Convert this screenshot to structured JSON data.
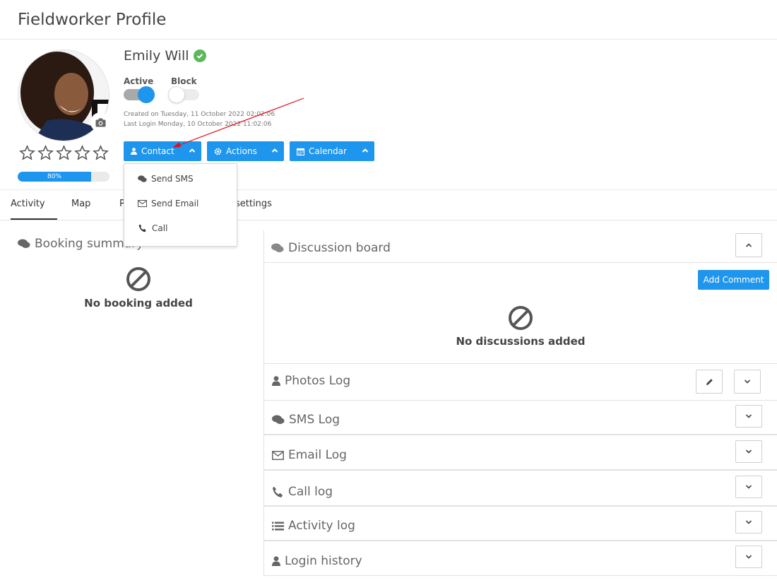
{
  "page": {
    "title": "Fieldworker Profile"
  },
  "profile": {
    "name": "Emily Will",
    "active_label": "Active",
    "block_label": "Block",
    "created": "Created on Tuesday, 11 October 2022 02:02:06",
    "last_login": "Last Login Monday, 10 October 2022 11:02:06",
    "rating_stars": 0,
    "progress_label": "80%",
    "progress_percent": 80,
    "active_on": true,
    "block_on": false
  },
  "buttons": {
    "contact": "Contact",
    "actions": "Actions",
    "calendar": "Calendar"
  },
  "dropdown": {
    "items": [
      "Send SMS",
      "Send Email",
      "Call"
    ]
  },
  "tabs": {
    "activity": "Activity",
    "map": "Map",
    "p_partial": "P",
    "settings_partial": "settings"
  },
  "booking": {
    "title": "Booking summary",
    "empty": "No booking added"
  },
  "discussion": {
    "title": "Discussion board",
    "add_comment": "Add Comment",
    "empty": "No discussions added"
  },
  "logs": {
    "photos": "Photos Log",
    "sms": "SMS Log",
    "email": "Email Log",
    "call": "Call log",
    "activity": "Activity log",
    "login": "Login history"
  },
  "colors": {
    "primary": "#1f96ee",
    "verified": "#5cb85c",
    "annotation_arrow": "#e0101e"
  }
}
